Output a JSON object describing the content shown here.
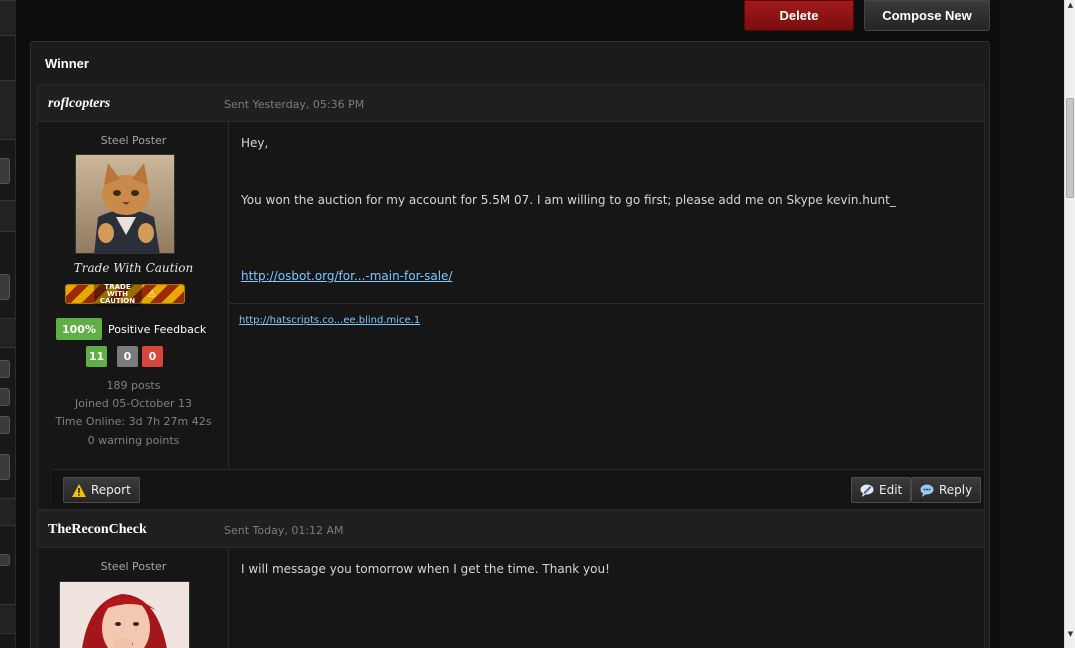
{
  "toolbar": {
    "delete_label": "Delete",
    "compose_label": "Compose New"
  },
  "conversation": {
    "title": "Winner"
  },
  "posts": [
    {
      "author": "roflcopters",
      "sent": "Sent Yesterday, 05:36 PM",
      "rank": "Steel Poster",
      "tag": "Trade With Caution",
      "badge_text": "TRADE WITH CAUTION",
      "feedback": {
        "percent": "100%",
        "label": "Positive Feedback",
        "positive": "11",
        "neutral": "0",
        "negative": "0"
      },
      "stats": {
        "posts": "189 posts",
        "joined": "Joined 05-October 13",
        "time_online": "Time Online: 3d 7h 27m 42s",
        "warnings": "0 warning points"
      },
      "body": {
        "line1": "Hey,",
        "line2": "You won the auction for my account for 5.5M 07. I am willing to go first; please add me on Skype kevin.hunt_",
        "link": "http://osbot.org/for...-main-for-sale/"
      },
      "signature_link": "http://hatscripts.co...ee.blind.mice.1",
      "actions": {
        "report": "Report",
        "edit": "Edit",
        "reply": "Reply"
      }
    },
    {
      "author": "TheReconCheck",
      "sent": "Sent Today, 01:12 AM",
      "rank": "Steel Poster",
      "body": {
        "line1": "I will message you tomorrow when I get the time. Thank you!"
      }
    }
  ],
  "colors": {
    "delete": "#8e1414",
    "feedback_positive": "#5fae46",
    "feedback_neutral": "#7a7a7a",
    "feedback_negative": "#d9453b",
    "link": "#7fc6ff"
  }
}
